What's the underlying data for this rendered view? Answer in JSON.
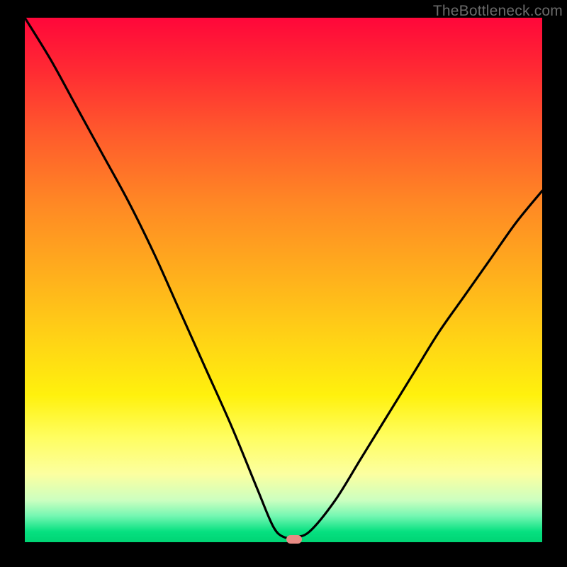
{
  "watermark": "TheBottleneck.com",
  "chart_data": {
    "type": "line",
    "title": "",
    "xlabel": "",
    "ylabel": "",
    "xlim": [
      0,
      100
    ],
    "ylim": [
      0,
      100
    ],
    "series": [
      {
        "name": "curve",
        "x": [
          0,
          5,
          10,
          15,
          20,
          25,
          30,
          35,
          40,
          45,
          48,
          50,
          52,
          55,
          60,
          65,
          70,
          75,
          80,
          85,
          90,
          95,
          100
        ],
        "y": [
          100,
          92,
          83,
          74,
          65,
          55,
          44,
          33,
          22,
          10,
          3,
          1,
          1,
          2,
          8,
          16,
          24,
          32,
          40,
          47,
          54,
          61,
          67
        ]
      }
    ],
    "marker": {
      "x": 52,
      "y": 0.5
    },
    "gradient_stops": [
      {
        "pos": 0,
        "color": "#ff073a"
      },
      {
        "pos": 50,
        "color": "#ffb21c"
      },
      {
        "pos": 75,
        "color": "#fff10d"
      },
      {
        "pos": 95,
        "color": "#74f7b2"
      },
      {
        "pos": 100,
        "color": "#00d474"
      }
    ]
  }
}
